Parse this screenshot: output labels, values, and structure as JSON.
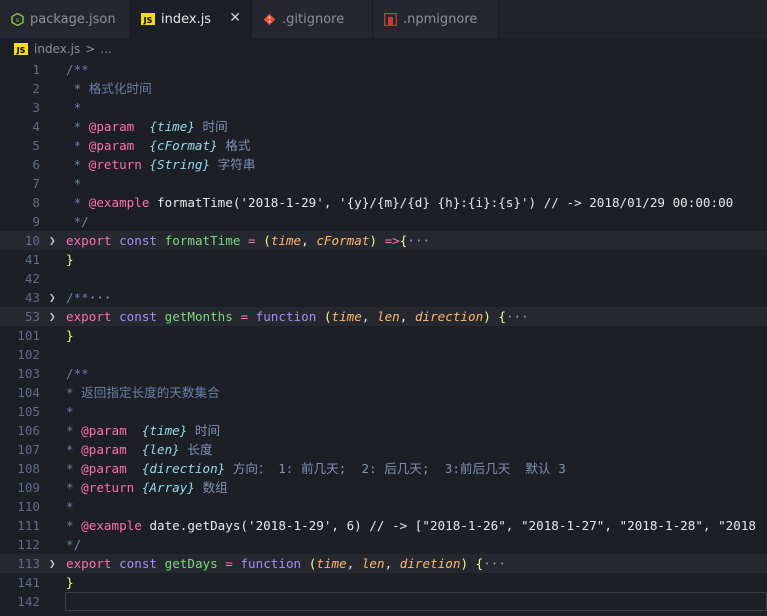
{
  "tabs": [
    {
      "label": "package.json",
      "icon": "nodejs-icon",
      "active": false
    },
    {
      "label": "index.js",
      "icon": "js-icon",
      "active": true,
      "close": "✕"
    },
    {
      "label": ".gitignore",
      "icon": "git-icon",
      "active": false
    },
    {
      "label": ".npmignore",
      "icon": "npm-icon",
      "active": false
    }
  ],
  "breadcrumb": {
    "file": "index.js",
    "sep": ">",
    "rest": "..."
  },
  "code": {
    "lines": [
      {
        "n": "1",
        "t": "/**"
      },
      {
        "n": "2",
        "t": " * 格式化时间"
      },
      {
        "n": "3",
        "t": " *"
      },
      {
        "n": "4",
        "t": " * @param  {time} 时间"
      },
      {
        "n": "5",
        "t": " * @param  {cFormat} 格式"
      },
      {
        "n": "6",
        "t": " * @return {String} 字符串"
      },
      {
        "n": "7",
        "t": " *"
      },
      {
        "n": "8",
        "t": " * @example formatTime('2018-1-29', '{y}/{m}/{d} {h}:{i}:{s}') // -> 2018/01/29 00:00:00"
      },
      {
        "n": "9",
        "t": " */"
      },
      {
        "n": "10",
        "t": "export const formatTime = (time, cFormat) =>{···"
      },
      {
        "n": "41",
        "t": "}"
      },
      {
        "n": "42",
        "t": ""
      },
      {
        "n": "43",
        "t": "/**···"
      },
      {
        "n": "53",
        "t": "export const getMonths = function (time, len, direction) {···"
      },
      {
        "n": "101",
        "t": "}"
      },
      {
        "n": "102",
        "t": ""
      },
      {
        "n": "103",
        "t": "/**"
      },
      {
        "n": "104",
        "t": "* 返回指定长度的天数集合"
      },
      {
        "n": "105",
        "t": "*"
      },
      {
        "n": "106",
        "t": "* @param  {time} 时间"
      },
      {
        "n": "107",
        "t": "* @param  {len} 长度"
      },
      {
        "n": "108",
        "t": "* @param  {direction} 方向： 1: 前几天;  2: 后几天;  3:前后几天  默认 3"
      },
      {
        "n": "109",
        "t": "* @return {Array} 数组"
      },
      {
        "n": "110",
        "t": "*"
      },
      {
        "n": "111",
        "t": "* @example date.getDays('2018-1-29', 6) // -> [\"2018-1-26\", \"2018-1-27\", \"2018-1-28\", \"2018"
      },
      {
        "n": "112",
        "t": "*/"
      },
      {
        "n": "113",
        "t": "export const getDays = function (time, len, diretion) {···"
      },
      {
        "n": "141",
        "t": "}"
      },
      {
        "n": "142",
        "t": ""
      }
    ]
  },
  "colors": {
    "background": "#1d1f27",
    "comment": "#6a7fa8",
    "jsdoc_tag": "#ff6fb0",
    "type": "#8fdcea",
    "keyword": "#ff6fb0",
    "function": "#7dd87d",
    "parameter": "#ffb86c"
  }
}
